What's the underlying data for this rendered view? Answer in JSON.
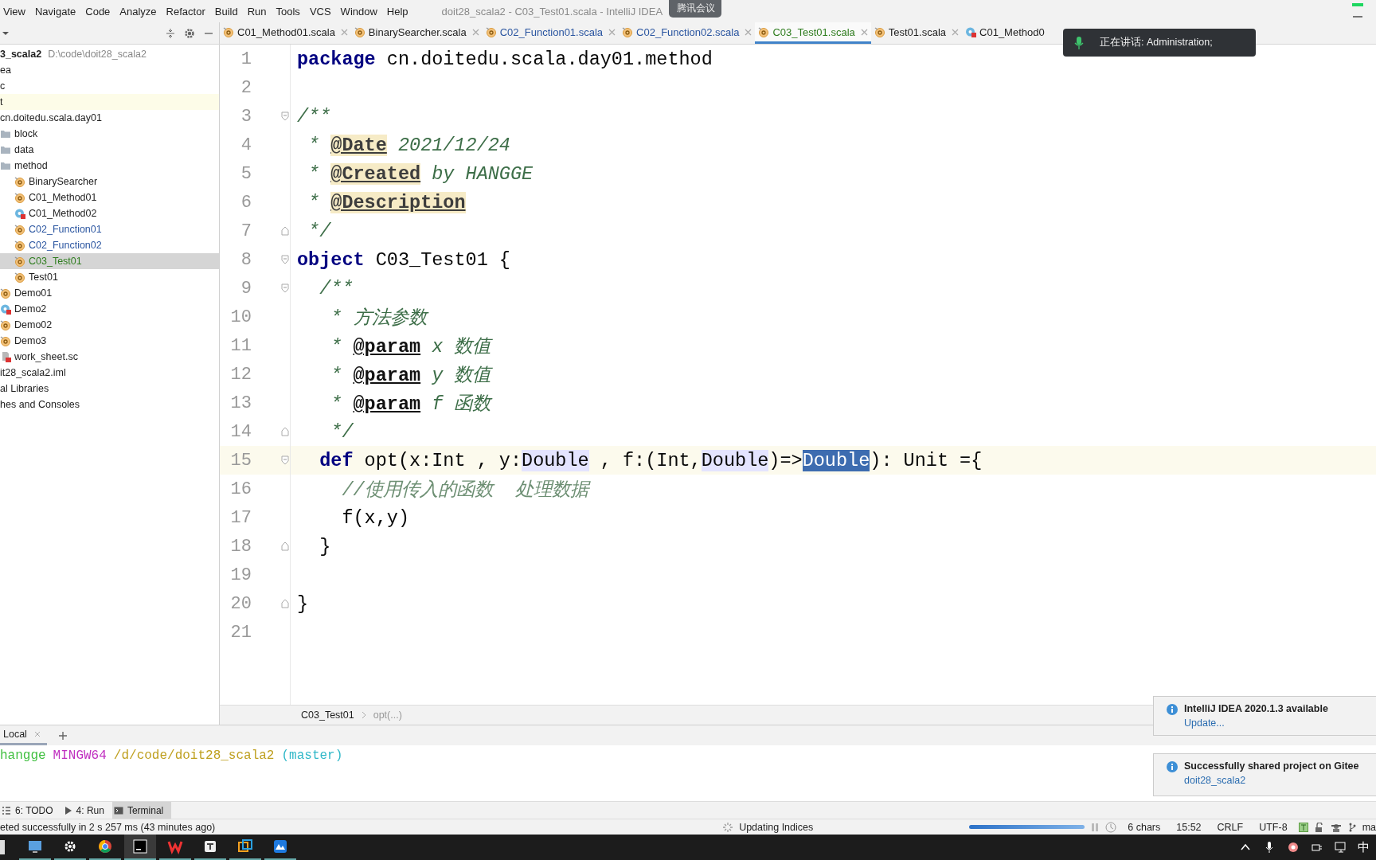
{
  "menu_bar": {
    "items": [
      "View",
      "Navigate",
      "Code",
      "Analyze",
      "Refactor",
      "Build",
      "Run",
      "Tools",
      "VCS",
      "Window",
      "Help"
    ],
    "title": "doit28_scala2 - C03_Test01.scala - IntelliJ IDEA",
    "meeting_badge": "腾讯会议"
  },
  "voice_popup": {
    "text": "正在讲话: Administration;"
  },
  "tabs": [
    {
      "label": "C01_Method01.scala",
      "kind": "object",
      "color": "#1e1e1e",
      "selected": false
    },
    {
      "label": "BinarySearcher.scala",
      "kind": "object",
      "color": "#1e1e1e",
      "selected": false
    },
    {
      "label": "C02_Function01.scala",
      "kind": "object",
      "color": "#2a55a0",
      "selected": false
    },
    {
      "label": "C02_Function02.scala",
      "kind": "object",
      "color": "#2a55a0",
      "selected": false
    },
    {
      "label": "C03_Test01.scala",
      "kind": "object",
      "color": "#2f7d1f",
      "selected": true
    },
    {
      "label": "Test01.scala",
      "kind": "object",
      "color": "#1e1e1e",
      "selected": false
    },
    {
      "label": "C01_Method0",
      "kind": "class",
      "color": "#1e1e1e",
      "selected": false
    }
  ],
  "project_tree": [
    {
      "label": "3_scala2",
      "path": "D:\\code\\doit28_scala2",
      "selected": false,
      "highlighted": false
    },
    {
      "label": "ea",
      "selected": false,
      "highlighted": false
    },
    {
      "label": "c",
      "selected": false,
      "highlighted": false
    },
    {
      "label": "t",
      "selected": false,
      "highlighted": true
    },
    {
      "label": "cn.doitedu.scala.day01",
      "selected": false,
      "highlighted": false,
      "children": [
        {
          "label": "block",
          "kind": "folder",
          "color": "#1e1e1e",
          "selected": false,
          "highlighted": false
        },
        {
          "label": "data",
          "kind": "folder",
          "color": "#1e1e1e",
          "selected": false,
          "highlighted": false
        },
        {
          "label": "method",
          "kind": "folder",
          "color": "#1e1e1e",
          "selected": false,
          "highlighted": false,
          "children": [
            {
              "label": "BinarySearcher",
              "kind": "object",
              "color": "#1e1e1e",
              "selected": false,
              "highlighted": false
            },
            {
              "label": "C01_Method01",
              "kind": "object",
              "color": "#1e1e1e",
              "selected": false,
              "highlighted": false
            },
            {
              "label": "C01_Method02",
              "kind": "class",
              "color": "#1e1e1e",
              "selected": false,
              "highlighted": false
            },
            {
              "label": "C02_Function01",
              "kind": "object",
              "color": "#2a55a0",
              "selected": false,
              "highlighted": false
            },
            {
              "label": "C02_Function02",
              "kind": "object",
              "color": "#2a55a0",
              "selected": false,
              "highlighted": false
            },
            {
              "label": "C03_Test01",
              "kind": "object",
              "color": "#2f7d1f",
              "selected": true,
              "highlighted": false
            },
            {
              "label": "Test01",
              "kind": "object",
              "color": "#1e1e1e",
              "selected": false,
              "highlighted": false
            }
          ]
        },
        {
          "label": "Demo01",
          "kind": "object",
          "color": "#1e1e1e",
          "selected": false,
          "highlighted": false
        },
        {
          "label": "Demo2",
          "kind": "class",
          "color": "#1e1e1e",
          "selected": false,
          "highlighted": false
        },
        {
          "label": "Demo02",
          "kind": "object",
          "color": "#1e1e1e",
          "selected": false,
          "highlighted": false
        },
        {
          "label": "Demo3",
          "kind": "object",
          "color": "#1e1e1e",
          "selected": false,
          "highlighted": false
        },
        {
          "label": "work_sheet.sc",
          "kind": "worksheet",
          "color": "#1e1e1e",
          "selected": false,
          "highlighted": false
        }
      ]
    },
    {
      "label": "it28_scala2.iml",
      "selected": false,
      "highlighted": false
    },
    {
      "label": "al Libraries",
      "selected": false,
      "highlighted": false
    },
    {
      "label": "hes and Consoles",
      "selected": false,
      "highlighted": false
    }
  ],
  "editor": {
    "lines": [
      {
        "number": "1",
        "current": false,
        "segments": [
          {
            "kind": "keyword",
            "text": "package"
          },
          {
            "kind": "plain",
            "text": " cn.doitedu.scala.day01.method"
          }
        ]
      },
      {
        "number": "2",
        "current": false
      },
      {
        "number": "3",
        "current": false,
        "fold_open": true,
        "fold_close": false,
        "segments": [
          {
            "kind": "doc",
            "text": "/**"
          }
        ]
      },
      {
        "number": "4",
        "current": false,
        "segments": [
          {
            "kind": "doc",
            "text": " * "
          },
          {
            "kind": "tag",
            "text": "@Date"
          },
          {
            "kind": "doc",
            "text": " 2021/12/24"
          }
        ]
      },
      {
        "number": "5",
        "current": false,
        "segments": [
          {
            "kind": "doc",
            "text": " * "
          },
          {
            "kind": "tag",
            "text": "@Created"
          },
          {
            "kind": "doc",
            "text": " by HANGGE"
          }
        ]
      },
      {
        "number": "6",
        "current": false,
        "segments": [
          {
            "kind": "doc",
            "text": " * "
          },
          {
            "kind": "tag",
            "text": "@Description"
          }
        ]
      },
      {
        "number": "7",
        "current": false,
        "fold_open": false,
        "fold_close": true,
        "segments": [
          {
            "kind": "doc",
            "text": " */"
          }
        ]
      },
      {
        "number": "8",
        "current": false,
        "fold_open": true,
        "fold_close": false,
        "segments": [
          {
            "kind": "keyword",
            "text": "object"
          },
          {
            "kind": "plain",
            "text": " C03_Test01 {"
          }
        ]
      },
      {
        "number": "9",
        "current": false,
        "fold_open": true,
        "fold_close": false,
        "segments": [
          {
            "kind": "doc",
            "text": "  /**"
          }
        ]
      },
      {
        "number": "10",
        "current": false,
        "segments": [
          {
            "kind": "doc",
            "text": "   * 方法参数"
          }
        ]
      },
      {
        "number": "11",
        "current": false,
        "segments": [
          {
            "kind": "doc",
            "text": "   * "
          },
          {
            "kind": "doctag",
            "text": "@param"
          },
          {
            "kind": "doc",
            "text": " x 数值"
          }
        ]
      },
      {
        "number": "12",
        "current": false,
        "segments": [
          {
            "kind": "doc",
            "text": "   * "
          },
          {
            "kind": "doctag",
            "text": "@param"
          },
          {
            "kind": "doc",
            "text": " y 数值"
          }
        ]
      },
      {
        "number": "13",
        "current": false,
        "segments": [
          {
            "kind": "doc",
            "text": "   * "
          },
          {
            "kind": "doctag",
            "text": "@param"
          },
          {
            "kind": "doc",
            "text": " f 函数"
          }
        ]
      },
      {
        "number": "14",
        "current": false,
        "fold_open": false,
        "fold_close": true,
        "segments": [
          {
            "kind": "doc",
            "text": "   */"
          }
        ]
      },
      {
        "number": "15",
        "current": true,
        "fold_open": true,
        "fold_close": false,
        "segments": [
          {
            "kind": "keyword",
            "text": "  def"
          },
          {
            "kind": "plain",
            "text": " opt(x:Int , y:"
          },
          {
            "kind": "usage",
            "text": "Double"
          },
          {
            "kind": "plain",
            "text": " , f:(Int,"
          },
          {
            "kind": "usage",
            "text": "Double"
          },
          {
            "kind": "plain",
            "text": ")=>"
          },
          {
            "kind": "selected",
            "text": "Double"
          },
          {
            "kind": "plain",
            "text": "): Unit ={"
          }
        ]
      },
      {
        "number": "16",
        "current": false,
        "segments": [
          {
            "kind": "comment",
            "text": "    //使用传入的函数  处理数据"
          }
        ]
      },
      {
        "number": "17",
        "current": false,
        "segments": [
          {
            "kind": "plain",
            "text": "    f(x,y)"
          }
        ]
      },
      {
        "number": "18",
        "current": false,
        "fold_open": false,
        "fold_close": true,
        "segments": [
          {
            "kind": "plain",
            "text": "  }"
          }
        ]
      },
      {
        "number": "19",
        "current": false
      },
      {
        "number": "20",
        "current": false,
        "fold_open": false,
        "fold_close": true,
        "segments": [
          {
            "kind": "plain",
            "text": "}"
          }
        ]
      },
      {
        "number": "21",
        "current": false
      }
    ]
  },
  "breadcrumb": [
    "C03_Test01",
    "opt(...)"
  ],
  "terminal": {
    "tab": "Local",
    "prompt": [
      {
        "text": "hangge",
        "color": "#3fbf3f"
      },
      {
        "text": "MINGW64",
        "color": "#c030c0"
      },
      {
        "text": "/d/code/doit28_scala2",
        "color": "#bfa020"
      },
      {
        "text": "(master)",
        "color": "#30b8c8"
      }
    ]
  },
  "tool_windows": [
    {
      "label": "6: TODO",
      "kind": "todo",
      "selected": false
    },
    {
      "label": "4: Run",
      "kind": "run",
      "selected": false
    },
    {
      "label": "Terminal",
      "kind": "terminal",
      "selected": true
    }
  ],
  "status_bar": {
    "message": "eted successfully in 2 s 257 ms (43 minutes ago)",
    "task": "Updating Indices",
    "level": 1,
    "selection": "6 chars",
    "position": "15:52",
    "line_ending": "CRLF",
    "encoding": "UTF-8",
    "branch": "ma"
  },
  "notifications": [
    {
      "title": "IntelliJ IDEA 2020.1.3 available",
      "link": "Update..."
    },
    {
      "title": "Successfully shared project on Gitee",
      "link": "doit28_scala2"
    }
  ],
  "taskbar": {
    "ime": "中"
  }
}
